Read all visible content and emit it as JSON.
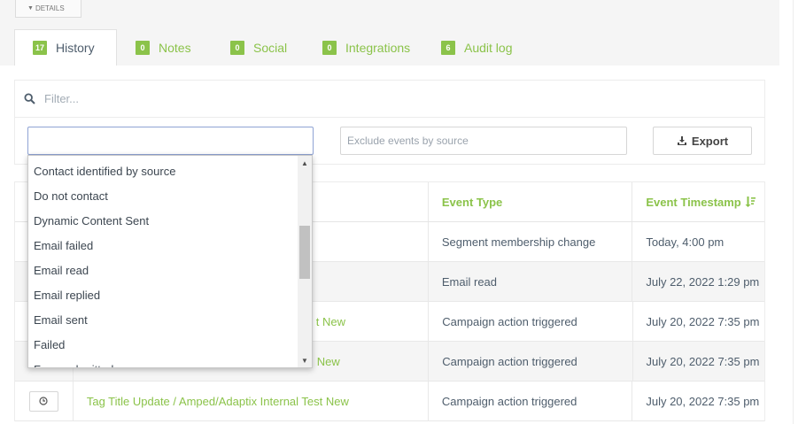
{
  "details_button": {
    "label": "DETAILS"
  },
  "tabs": [
    {
      "count": "17",
      "label": "History"
    },
    {
      "count": "0",
      "label": "Notes"
    },
    {
      "count": "0",
      "label": "Social"
    },
    {
      "count": "0",
      "label": "Integrations"
    },
    {
      "count": "6",
      "label": "Audit log"
    }
  ],
  "filter": {
    "placeholder": "Filter..."
  },
  "source_include": {
    "value": ""
  },
  "source_exclude": {
    "placeholder": "Exclude events by source"
  },
  "export": {
    "label": "Export"
  },
  "table": {
    "headers": {
      "event_type": "Event Type",
      "timestamp": "Event Timestamp"
    },
    "rows": [
      {
        "name": "",
        "type": "Segment membership change",
        "time": "Today, 4:00 pm"
      },
      {
        "name": "",
        "type": "Email read",
        "time": "July 22, 2022 1:29 pm"
      },
      {
        "name": "t New",
        "type": "Campaign action triggered",
        "time": "July 20, 2022 7:35 pm"
      },
      {
        "name": "New",
        "type": "Campaign action triggered",
        "time": "July 20, 2022 7:35 pm"
      },
      {
        "name": "Tag Title Update / Amped/Adaptix Internal Test New",
        "type": "Campaign action triggered",
        "time": "July 20, 2022 7:35 pm"
      }
    ]
  },
  "dropdown": {
    "options": [
      "Contact identified by source",
      "Do not contact",
      "Dynamic Content Sent",
      "Email failed",
      "Email read",
      "Email replied",
      "Email sent",
      "Failed",
      "Form submitted"
    ]
  },
  "colors": {
    "accent": "#8bc34a",
    "text": "#4e5d6c",
    "band": "#f5f5f5"
  },
  "icons": {
    "filter": "search-icon",
    "export": "download-icon",
    "row": "clock-icon",
    "sort": "sort-desc-icon"
  }
}
